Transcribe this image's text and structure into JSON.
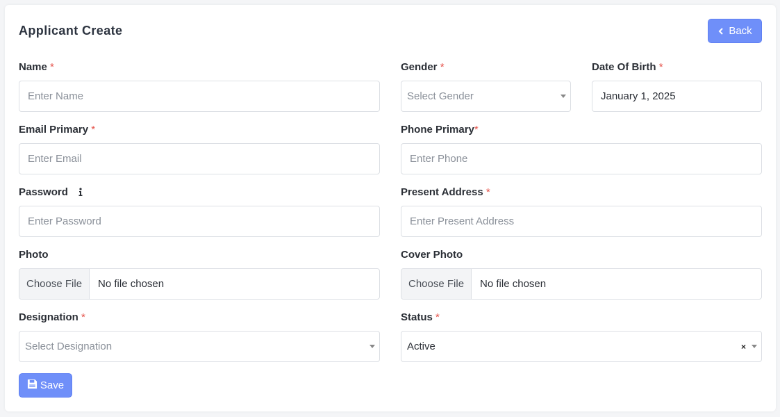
{
  "page": {
    "title": "Applicant Create"
  },
  "header": {
    "back_label": "Back"
  },
  "form": {
    "name": {
      "label": "Name",
      "required": "*",
      "placeholder": "Enter Name"
    },
    "gender": {
      "label": "Gender",
      "required": "*",
      "placeholder": "Select Gender"
    },
    "dob": {
      "label": "Date Of Birth",
      "required": "*",
      "value": "January 1, 2025"
    },
    "email": {
      "label": "Email Primary",
      "required": "*",
      "placeholder": "Enter Email"
    },
    "phone": {
      "label": "Phone Primary",
      "required": "*",
      "placeholder": "Enter Phone"
    },
    "password": {
      "label": "Password",
      "placeholder": "Enter Password"
    },
    "address": {
      "label": "Present Address",
      "required": "*",
      "placeholder": "Enter Present Address"
    },
    "photo": {
      "label": "Photo",
      "choose_label": "Choose File",
      "status": "No file chosen"
    },
    "cover_photo": {
      "label": "Cover Photo",
      "choose_label": "Choose File",
      "status": "No file chosen"
    },
    "designation": {
      "label": "Designation",
      "required": "*",
      "placeholder": "Select Designation"
    },
    "status": {
      "label": "Status",
      "required": "*",
      "value": "Active",
      "clear": "×"
    },
    "save_label": "Save"
  },
  "colors": {
    "primary": "#6f8ff9",
    "required": "#e5534b",
    "border": "#dcdfe4"
  },
  "icons": {
    "back": "chevron-left-icon",
    "info": "info-icon",
    "save": "save-icon",
    "caret": "caret-down-icon"
  }
}
